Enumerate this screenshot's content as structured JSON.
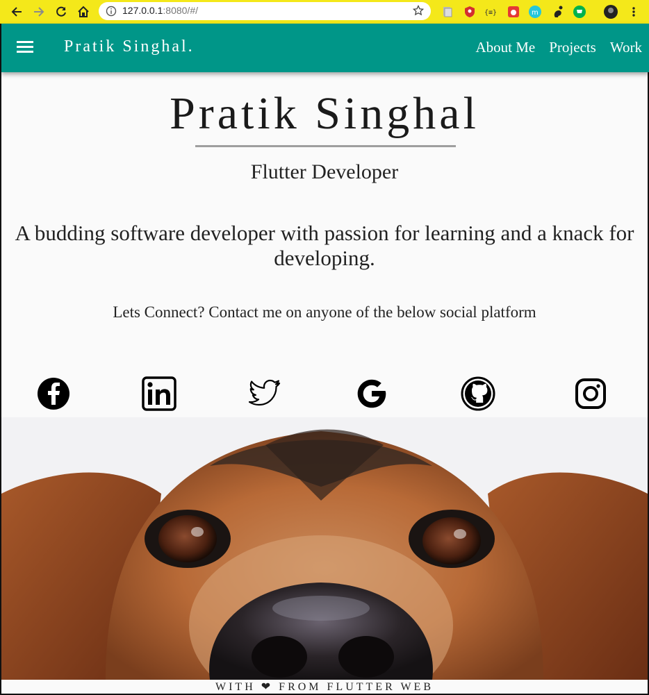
{
  "browser": {
    "url_host": "127.0.0.1",
    "url_rest": ":8080/#/"
  },
  "appbar": {
    "brand": "Pratik Singhal.",
    "nav": [
      "About Me",
      "Projects",
      "Work"
    ]
  },
  "hero": {
    "name": "Pratik Singhal",
    "role": "Flutter Developer",
    "tagline": "A budding software developer with passion for learning and a knack for developing.",
    "connect": "Lets Connect? Contact me on anyone of the below social platform"
  },
  "social": [
    "facebook-icon",
    "linkedin-icon",
    "twitter-icon",
    "google-icon",
    "github-icon",
    "instagram-icon"
  ],
  "footer": "WITH ❤ FROM FLUTTER WEB",
  "colors": {
    "appbar": "#009688",
    "browser_bar": "#f4e81a",
    "background": "#fafafa"
  }
}
